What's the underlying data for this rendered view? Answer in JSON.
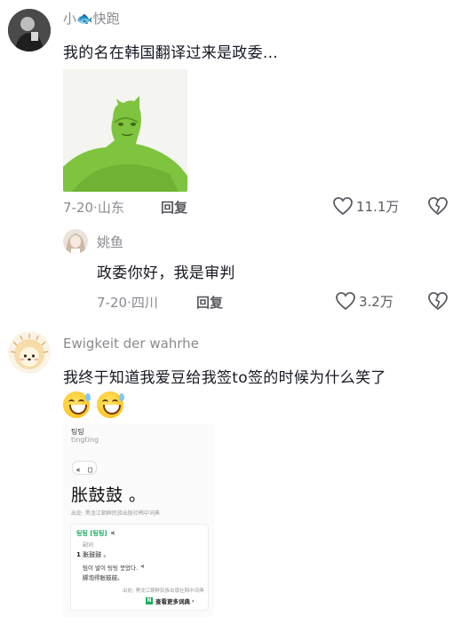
{
  "comments": [
    {
      "username": "小🐟快跑",
      "text": "我的名在韩国翻译过来是政委...",
      "date": "7-20",
      "location": "山东",
      "reply_label": "回复",
      "likes": "11.1万"
    },
    {
      "username": "姚鱼",
      "text": "政委你好，我是审判",
      "date": "7-20",
      "location": "四川",
      "reply_label": "回复",
      "likes": "3.2万"
    },
    {
      "username": "Ewigkeit der wahrhe",
      "text": "我终于知道我爱豆给我签to签的时候为什么笑了",
      "emoji_count": 2
    }
  ],
  "dictionary_card": {
    "word": "팅팅",
    "romanization": "tingting",
    "meaning": "胀鼓鼓 。",
    "source": "出处: 黑龙江朝鲜民族出版社韩中词典",
    "entry_head": "팅팅 [팅팅]",
    "entry_label": "副词",
    "sense_number": "1",
    "sense": "胀鼓鼓 。",
    "example_ko": "팀이 발이 팅팅 붓었다.",
    "example_zh": "脚泡得胀鼓鼓。",
    "entry_source": "出处: 黑龙江朝鲜民族出版社韩中词典",
    "more_label": "查看更多词典",
    "more_logo": "N"
  },
  "colors": {
    "text_primary": "#161823",
    "text_secondary": "#8a8b91",
    "dict_green": "#19ae5c"
  }
}
